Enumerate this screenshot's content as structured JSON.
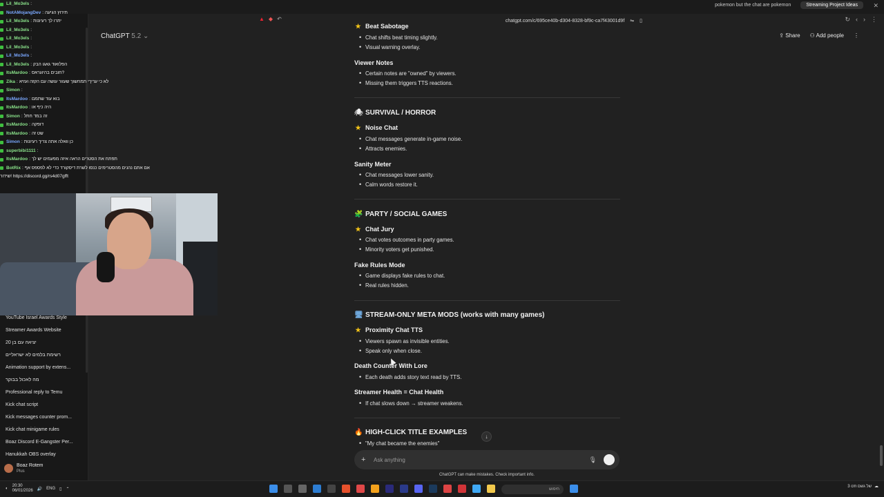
{
  "browser": {
    "tabs": [
      {
        "label": "pokemon but the chat are pokemon",
        "active": false
      },
      {
        "label": "Streaming Project Ideas",
        "active": true
      }
    ],
    "url": "chatgpt.com/c/695ce40b-d304-8328-bf9c-ca7f43001d9f"
  },
  "stream_chat": [
    {
      "user": "Lil_Mo3els",
      "msg": ""
    },
    {
      "user": "NotAMojangDev",
      "msg": "תירוץ הגיעה"
    },
    {
      "user": "Lil_Mo3els",
      "msg": "יתרו לך רעיונות"
    },
    {
      "user": "Lil_Mo3els",
      "msg": ""
    },
    {
      "user": "Lil_Mo3els",
      "msg": ""
    },
    {
      "user": "Lil_Mo3els",
      "msg": ""
    },
    {
      "user": "Lil_Mo3els",
      "msg": ""
    },
    {
      "user": "Lil_Mo3els",
      "msg": "הפלואוד גאגו הבק"
    },
    {
      "user": "ItsMardoo",
      "msg": "חובים בהיוגראס?"
    },
    {
      "user": "Zika",
      "msg": "לא כי עריךי תמחשוך שעוור עושה עם הקזה ועזיא"
    },
    {
      "user": "Simon",
      "msg": ""
    },
    {
      "user": "ItsMardoo",
      "msg": "בוא עוד שתמם"
    },
    {
      "user": "ItsMardoo",
      "msg": "היה כיף או"
    },
    {
      "user": "Simon",
      "msg": "זה במד חתל"
    },
    {
      "user": "ItsMardoo",
      "msg": "דופקה"
    },
    {
      "user": "ItsMardoo",
      "msg": "שט זה"
    },
    {
      "user": "Simon",
      "msg": "כן וואלה אתה צריך רעיונות"
    },
    {
      "user": "superbibi1111",
      "msg": ""
    },
    {
      "user": "ItsMardoo",
      "msg": "תפתח את הסטרים הראה איזה מפעמים יש לך"
    },
    {
      "user": "BotRix",
      "msg": "אם אתם נהנים מהסטרימים כנסו לשרת דיסקורד כדי לא לפספס אף"
    },
    {
      "user": "",
      "msg": "שידור! https://discord.gg/rs4d07gfft"
    }
  ],
  "sidebar": {
    "items": [
      "YouTube Israel Awards Style",
      "Streamer Awards Website",
      "יציאה עם בן 20",
      "רשימת בלמים לא ישראליים",
      "Animation support by extens...",
      "מה לאכול בבוקר",
      "Professional reply to Temu",
      "Kick chat script",
      "Kick messages counter prom...",
      "Kick chat minigame rules",
      "Boaz Discord E-Gangster Per...",
      "Hanukkah OBS overlay"
    ],
    "profile": {
      "name": "Boaz Rotem",
      "plan": "Plus"
    }
  },
  "header": {
    "model": "ChatGPT",
    "version": "5.2",
    "share": "Share",
    "add_people": "Add people"
  },
  "content": {
    "sections": [
      {
        "heading": "Beat Sabotage",
        "bullets": [
          "Chat shifts beat timing slightly.",
          "Visual warning overlay."
        ]
      },
      {
        "heading": "Viewer Notes",
        "bullets": [
          "Certain notes are \"owned\" by viewers.",
          "Missing them triggers TTS reactions."
        ]
      },
      {
        "title": "SURVIVAL / HORROR",
        "emoji": "🕷"
      },
      {
        "heading": "Noise Chat",
        "star": true,
        "bullets": [
          "Chat messages generate in-game noise.",
          "Attracts enemies."
        ]
      },
      {
        "heading": "Sanity Meter",
        "bullets": [
          "Chat messages lower sanity.",
          "Calm words restore it."
        ]
      },
      {
        "title": "PARTY / SOCIAL GAMES",
        "emoji": "🧩"
      },
      {
        "heading": "Chat Jury",
        "star": true,
        "bullets": [
          "Chat votes outcomes in party games.",
          "Minority voters get punished."
        ]
      },
      {
        "heading": "Fake Rules Mode",
        "bullets": [
          "Game displays fake rules to chat.",
          "Real rules hidden."
        ]
      },
      {
        "title": "STREAM-ONLY META MODS (works with many games)",
        "emoji": "🖥"
      },
      {
        "heading": "Proximity Chat TTS",
        "star": true,
        "bullets": [
          "Viewers spawn as invisible entities.",
          "Speak only when close."
        ]
      },
      {
        "heading": "Death Counter With Lore",
        "bullets": [
          "Each death adds story text read by TTS."
        ]
      },
      {
        "heading": "Streamer Health = Chat Health",
        "bullets": [
          "If chat slows down → streamer weakens."
        ]
      },
      {
        "title": "HIGH-CLICK TITLE EXAMPLES",
        "emoji": "🔥"
      },
      {
        "bullets": [
          "\"My chat became the enemies\""
        ]
      }
    ]
  },
  "composer": {
    "placeholder": "Ask anything"
  },
  "disclaimer": "ChatGPT can make mistakes. Check important info.",
  "taskbar": {
    "time": "20:30",
    "date": "06/01/2026",
    "lang": "ENG",
    "search": "חיפוש",
    "weather": "3 cm של גשם"
  },
  "colors": {
    "background": "#212121",
    "sidebar": "#181818",
    "accent_star": "#f5c518"
  }
}
